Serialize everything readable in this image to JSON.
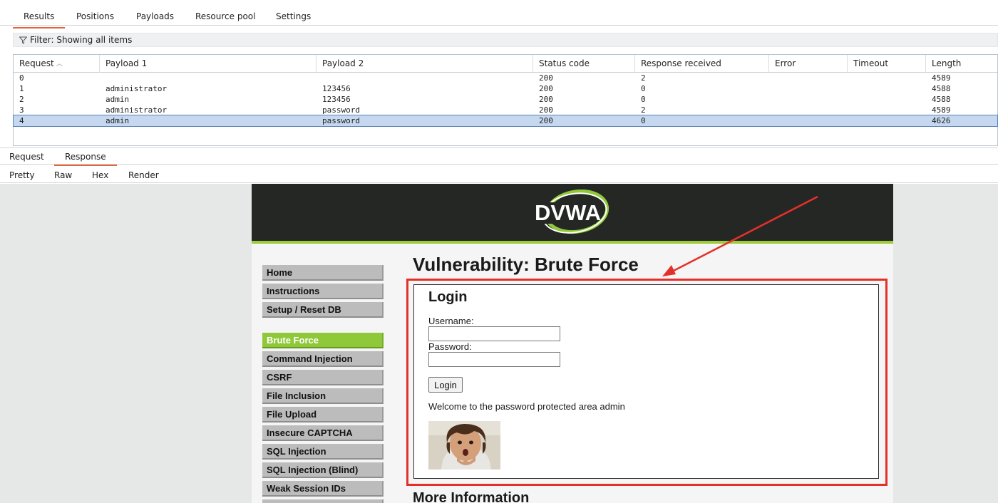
{
  "top_tabs": [
    {
      "label": "Results",
      "active": true
    },
    {
      "label": "Positions",
      "active": false
    },
    {
      "label": "Payloads",
      "active": false
    },
    {
      "label": "Resource pool",
      "active": false
    },
    {
      "label": "Settings",
      "active": false
    }
  ],
  "filter": {
    "icon": "filter-icon",
    "text": "Filter: Showing all items"
  },
  "results_table": {
    "columns": [
      "Request",
      "Payload 1",
      "Payload 2",
      "Status code",
      "Response received",
      "Error",
      "Timeout",
      "Length"
    ],
    "sorted_column": "Request",
    "sort_icon": "sort-ascending-icon",
    "rows": [
      {
        "request": "0",
        "payload1": "",
        "payload2": "",
        "status": "200",
        "received": "2",
        "error": "",
        "timeout": "",
        "length": "4589",
        "selected": false
      },
      {
        "request": "1",
        "payload1": "administrator",
        "payload2": "123456",
        "status": "200",
        "received": "0",
        "error": "",
        "timeout": "",
        "length": "4588",
        "selected": false
      },
      {
        "request": "2",
        "payload1": "admin",
        "payload2": "123456",
        "status": "200",
        "received": "0",
        "error": "",
        "timeout": "",
        "length": "4588",
        "selected": false
      },
      {
        "request": "3",
        "payload1": "administrator",
        "payload2": "password",
        "status": "200",
        "received": "2",
        "error": "",
        "timeout": "",
        "length": "4589",
        "selected": false
      },
      {
        "request": "4",
        "payload1": "admin",
        "payload2": "password",
        "status": "200",
        "received": "0",
        "error": "",
        "timeout": "",
        "length": "4626",
        "selected": true
      }
    ]
  },
  "message_tabs": [
    {
      "label": "Request",
      "active": false
    },
    {
      "label": "Response",
      "active": true
    }
  ],
  "view_tabs": [
    {
      "label": "Pretty",
      "active": false
    },
    {
      "label": "Raw",
      "active": false
    },
    {
      "label": "Hex",
      "active": false
    },
    {
      "label": "Render",
      "active": true
    }
  ],
  "dvwa": {
    "logo_text": "DVWA",
    "menu": [
      {
        "label": "Home",
        "active": false
      },
      {
        "label": "Instructions",
        "active": false
      },
      {
        "label": "Setup / Reset DB",
        "active": false
      },
      {
        "label": "Brute Force",
        "active": true
      },
      {
        "label": "Command Injection",
        "active": false
      },
      {
        "label": "CSRF",
        "active": false
      },
      {
        "label": "File Inclusion",
        "active": false
      },
      {
        "label": "File Upload",
        "active": false
      },
      {
        "label": "Insecure CAPTCHA",
        "active": false
      },
      {
        "label": "SQL Injection",
        "active": false
      },
      {
        "label": "SQL Injection (Blind)",
        "active": false
      },
      {
        "label": "Weak Session IDs",
        "active": false
      }
    ],
    "page_title": "Vulnerability: Brute Force",
    "login": {
      "title": "Login",
      "username_label": "Username:",
      "username_value": "",
      "password_label": "Password:",
      "password_value": "",
      "button_label": "Login"
    },
    "welcome_message": "Welcome to the password protected area admin",
    "more_info_heading": "More Information"
  },
  "colors": {
    "burp_accent": "#e2643b",
    "selected_row": "#c5d8f0",
    "dvwa_header": "#252724",
    "dvwa_green": "#8fc93a",
    "annotation_red": "#e4302a"
  }
}
